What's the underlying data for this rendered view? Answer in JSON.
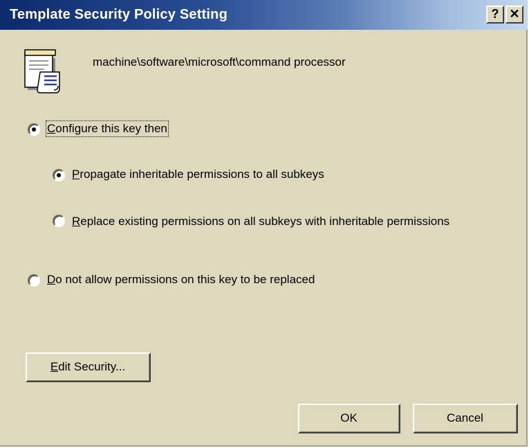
{
  "window": {
    "title": "Template Security Policy Setting",
    "help_label": "?",
    "close_label": "✕"
  },
  "header": {
    "icon": "document-scroll-icon",
    "registry_path": "machine\\software\\microsoft\\command processor"
  },
  "options": {
    "configure": {
      "mnemonic": "C",
      "rest": "onfigure this key then",
      "checked": true
    },
    "propagate": {
      "mnemonic": "P",
      "rest": "ropagate inheritable permissions to all subkeys",
      "checked": true
    },
    "replace": {
      "mnemonic": "R",
      "rest": "eplace existing permissions on all subkeys with inheritable permissions",
      "checked": false
    },
    "deny": {
      "mnemonic": "D",
      "rest": "o not allow permissions on this key to be replaced",
      "checked": false
    }
  },
  "buttons": {
    "edit_security_mnemonic": "E",
    "edit_security_rest": "dit Security...",
    "ok": "OK",
    "cancel": "Cancel"
  },
  "colors": {
    "dialog_bg": "#ded9bc",
    "title_gradient_start": "#0c2a6e",
    "title_gradient_end": "#c4d7ee"
  }
}
